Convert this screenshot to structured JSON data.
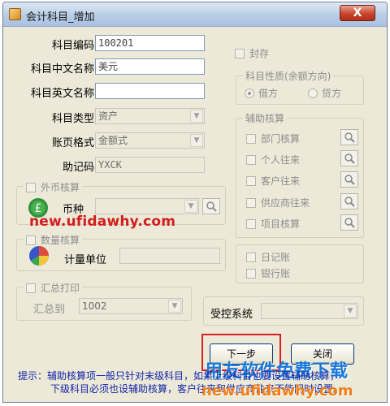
{
  "window": {
    "title": "会计科目_增加",
    "close_label": "X"
  },
  "form": {
    "code_label": "科目编码",
    "code_value": "100201",
    "cn_name_label": "科目中文名称",
    "cn_name_value": "美元",
    "en_name_label": "科目英文名称",
    "en_name_value": "",
    "type_label": "科目类型",
    "type_value": "资产",
    "ledger_label": "账页格式",
    "ledger_value": "金额式",
    "mnemonic_label": "助记码",
    "mnemonic_value": "YXCK"
  },
  "foreign_currency": {
    "title": "外币核算",
    "currency_label": "币种",
    "currency_value": ""
  },
  "quantity": {
    "title": "数量核算",
    "unit_label": "计量单位",
    "unit_value": ""
  },
  "summary_print": {
    "title": "汇总打印",
    "summarize_to_label": "汇总到",
    "summarize_to_value": "1002"
  },
  "sealed": {
    "label": "封存"
  },
  "nature": {
    "title": "科目性质(余额方向)",
    "debit_label": "借方",
    "credit_label": "贷方",
    "selected": "debit"
  },
  "aux": {
    "title": "辅助核算",
    "items": [
      {
        "label": "部门核算"
      },
      {
        "label": "个人往来"
      },
      {
        "label": "客户往来"
      },
      {
        "label": "供应商往来"
      },
      {
        "label": "项目核算"
      }
    ]
  },
  "journals": {
    "daily_label": "日记账",
    "bank_label": "银行账"
  },
  "controlled": {
    "label": "受控系统",
    "value": ""
  },
  "buttons": {
    "next_label": "下一步",
    "close_label": "关闭"
  },
  "hint": {
    "line1": "提示：辅助核算项一般只针对末级科目，如果上级科目也要设置辅助核算，",
    "line2": "下级科目必须也设辅助核算，客户往来和供应商往来不能同时设置。"
  },
  "watermarks": {
    "url": "new.ufidawhy.com",
    "brand": "用友软件免费下载",
    "url_bottom": "new.ufidawhy.com"
  },
  "colors": {
    "next_button_highlight": "#d42020",
    "hint_text": "#1426a8",
    "watermark_red": "#d41c1c",
    "watermark_blue": "#1b78d8",
    "watermark_orange": "#f07f18"
  }
}
